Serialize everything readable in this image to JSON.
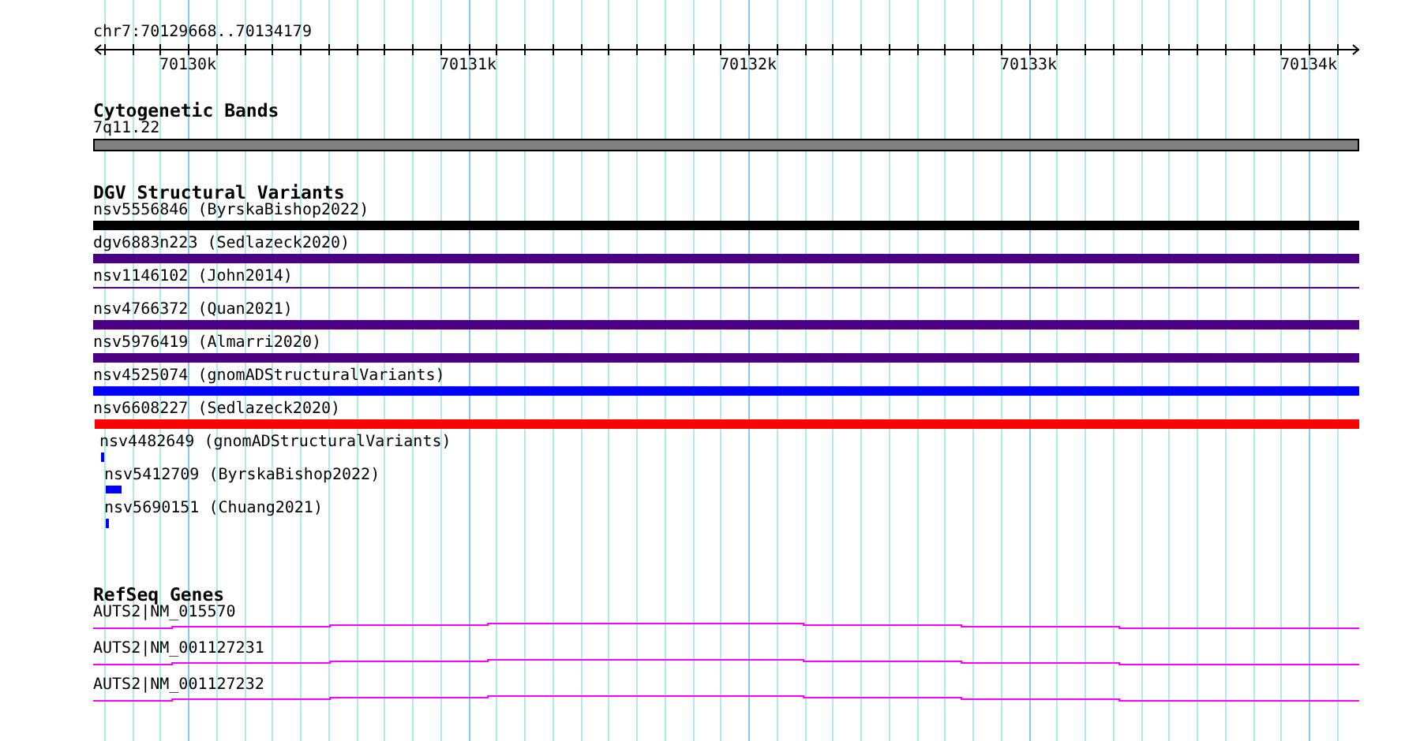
{
  "ruler": {
    "location": "chr7:70129668..70134179",
    "tick_labels": [
      "70130k",
      "70131k",
      "70132k",
      "70133k",
      "70134k"
    ]
  },
  "tracks": [
    {
      "title": "Cytogenetic Bands",
      "kind": "bands",
      "features": [
        {
          "label": "7q11.22",
          "color": "#808080"
        }
      ]
    },
    {
      "title": "DGV Structural Variants",
      "kind": "variants",
      "features": [
        {
          "label": "nsv5556846 (ByrskaBishop2022)",
          "color": "#000000"
        },
        {
          "label": "dgv6883n223 (Sedlazeck2020)",
          "color": "#4b0082"
        },
        {
          "label": "nsv1146102 (John2014)",
          "color": "#4b0082"
        },
        {
          "label": "nsv4766372 (Quan2021)",
          "color": "#4b0082"
        },
        {
          "label": "nsv5976419 (Almarri2020)",
          "color": "#4b0082"
        },
        {
          "label": "nsv4525074 (gnomADStructuralVariants)",
          "color": "#0000ff"
        },
        {
          "label": "nsv6608227 (Sedlazeck2020)",
          "color": "#ff0000"
        },
        {
          "label": "nsv4482649 (gnomADStructuralVariants)",
          "color": "#0000ff"
        },
        {
          "label": "nsv5412709 (ByrskaBishop2022)",
          "color": "#0000ff"
        },
        {
          "label": "nsv5690151 (Chuang2021)",
          "color": "#0000ff"
        }
      ]
    },
    {
      "title": "RefSeq Genes",
      "kind": "genes",
      "features": [
        {
          "label": "AUTS2|NM_015570"
        },
        {
          "label": "AUTS2|NM_001127231"
        },
        {
          "label": "AUTS2|NM_001127232"
        }
      ]
    }
  ]
}
